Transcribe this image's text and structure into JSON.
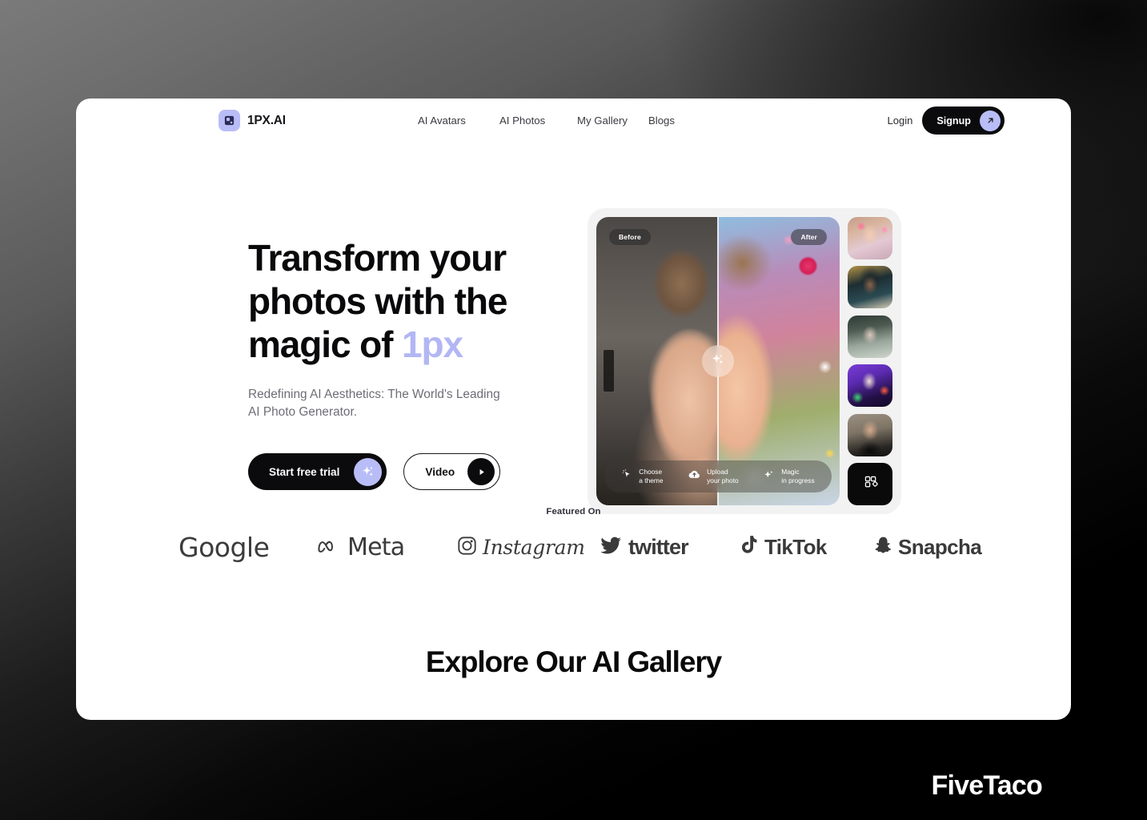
{
  "header": {
    "brand_name": "1PX.AI",
    "brand_icon": "app-logo-icon",
    "nav": [
      {
        "label": "AI Avatars"
      },
      {
        "label": "AI Photos"
      },
      {
        "label": "My Gallery"
      },
      {
        "label": "Blogs"
      }
    ],
    "login_label": "Login",
    "signup_label": "Signup",
    "signup_icon": "arrow-up-right-icon"
  },
  "hero": {
    "title_line1": "Transform your",
    "title_line2": "photos with the",
    "title_line3_prefix": "magic of ",
    "title_accent": "1px",
    "subtitle": "Redefining AI Aesthetics: The World's Leading AI Photo Generator.",
    "primary_cta": "Start free trial",
    "primary_cta_icon": "sparkle-icon",
    "secondary_cta": "Video",
    "secondary_cta_icon": "play-icon",
    "accent_color": "#b2b6f4",
    "button_color": "#0b0b0d"
  },
  "showcase": {
    "before_label": "Before",
    "after_label": "After",
    "slider_icon": "sparkle-icon",
    "steps": [
      {
        "icon": "cursor-sparkle-icon",
        "line1": "Choose",
        "line2": "a theme"
      },
      {
        "icon": "cloud-upload-icon",
        "line1": "Upload",
        "line2": "your photo"
      },
      {
        "icon": "sparkle-icon",
        "line1": "Magic",
        "line2": "in progress"
      }
    ],
    "thumbnails": [
      {
        "name": "thumbnail-floral-portrait"
      },
      {
        "name": "thumbnail-golden-portrait"
      },
      {
        "name": "thumbnail-veil-portrait"
      },
      {
        "name": "thumbnail-neon-portrait"
      },
      {
        "name": "thumbnail-male-portrait"
      },
      {
        "name": "thumbnail-view-all",
        "icon": "grid-icon"
      }
    ]
  },
  "featured": {
    "label": "Featured On",
    "logos": [
      {
        "name": "Google",
        "icon": "google-logo"
      },
      {
        "name": "Meta",
        "icon": "meta-logo"
      },
      {
        "name": "Instagram",
        "icon": "instagram-logo"
      },
      {
        "name": "twitter",
        "icon": "twitter-logo"
      },
      {
        "name": "TikTok",
        "icon": "tiktok-logo"
      },
      {
        "name": "Snapcha",
        "icon": "snapchat-logo"
      }
    ]
  },
  "gallery": {
    "heading": "Explore Our AI Gallery"
  },
  "watermark": {
    "text": "FiveTaco"
  }
}
